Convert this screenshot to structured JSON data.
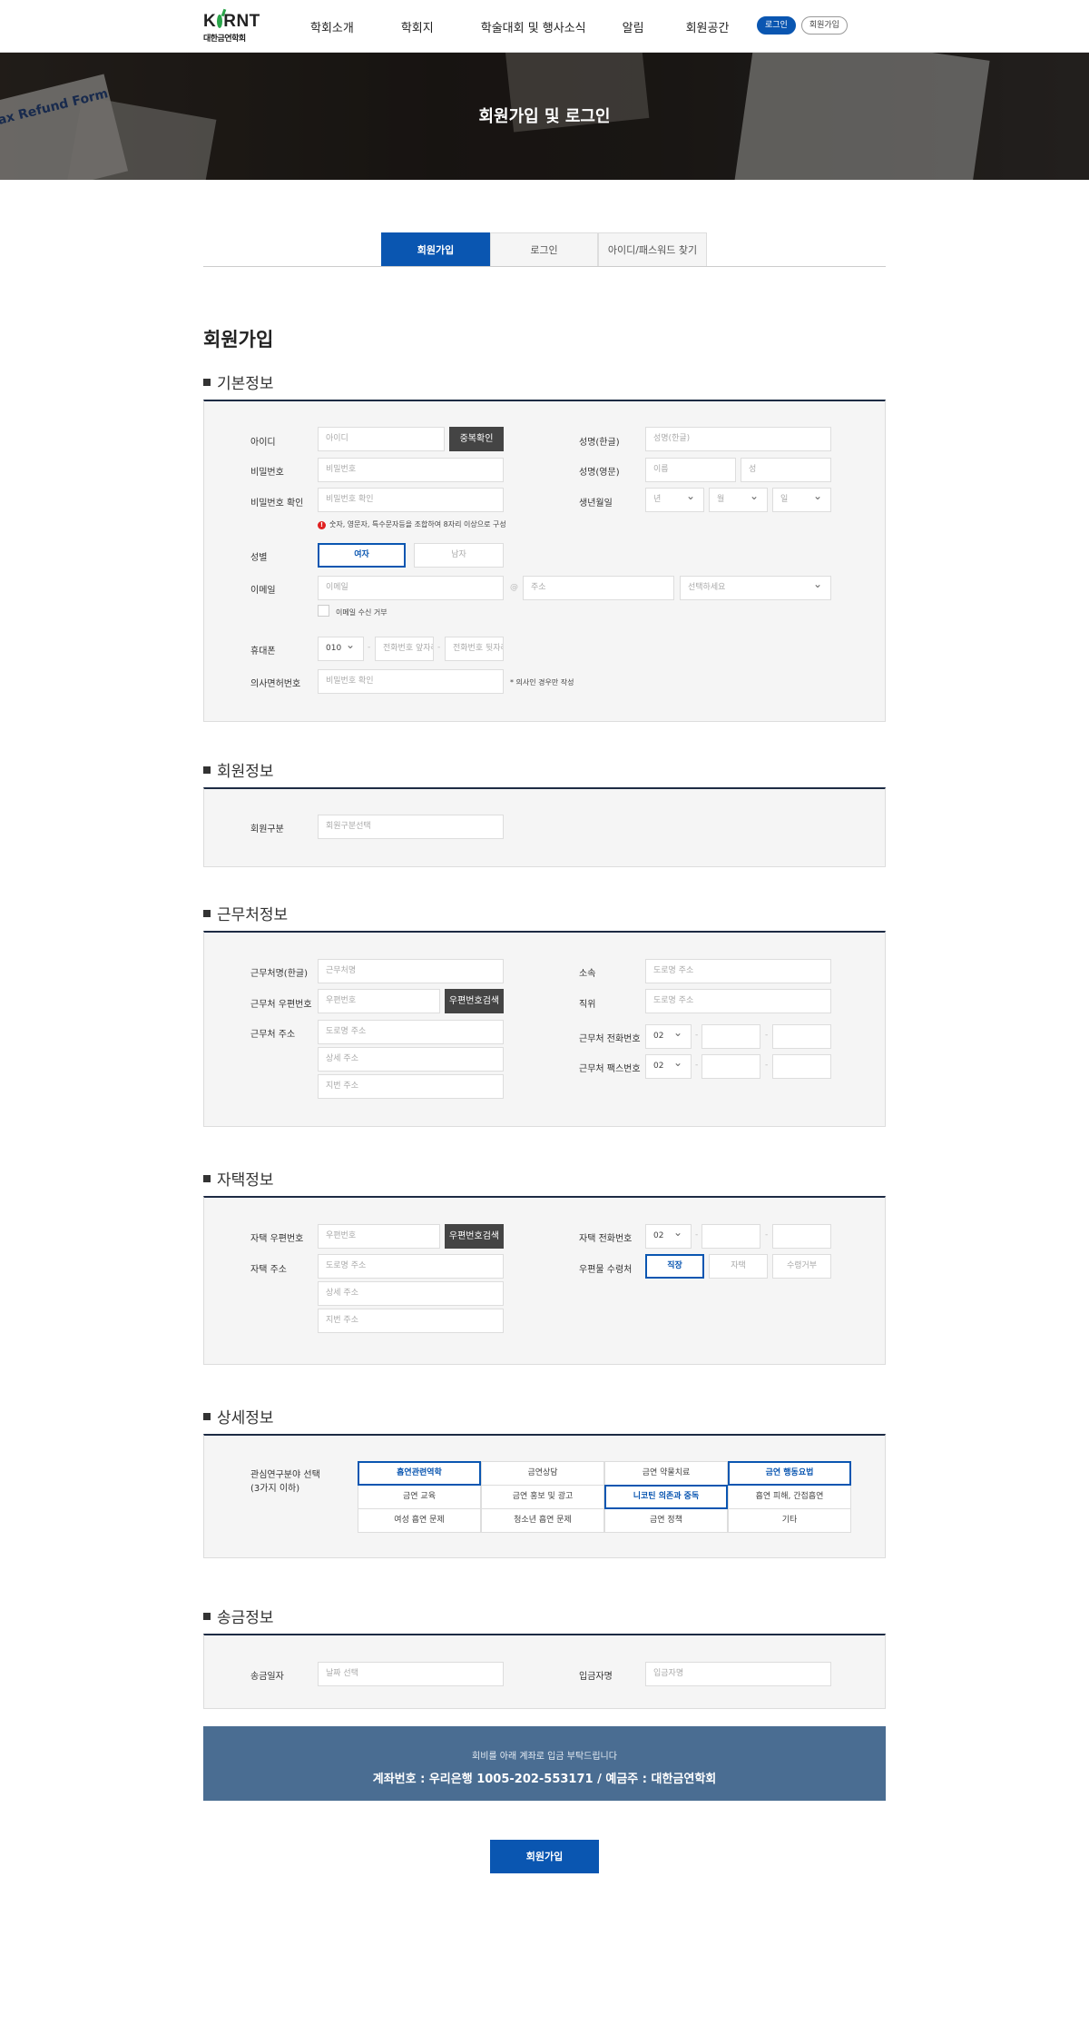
{
  "header": {
    "logo_text": "KORNT",
    "logo_sub": "대한금연학회",
    "nav": [
      "학회소개",
      "학회지",
      "학술대회 및 행사소식",
      "알림",
      "회원공간"
    ],
    "login_button": "로그인",
    "join_button": "회원가입"
  },
  "banner": {
    "title": "회원가입 및 로그인",
    "paper_text": "ax Refund Form"
  },
  "tabs": [
    "회원가입",
    "로그인",
    "아이디/패스워드 찾기"
  ],
  "page_title": "회원가입",
  "basic": {
    "title": "기본정보",
    "id_label": "아이디",
    "id_placeholder": "아이디",
    "dup_check": "중복확인",
    "pw_label": "비밀번호",
    "pw_placeholder": "비밀번호",
    "pw2_label": "비밀번호 확인",
    "pw2_placeholder": "비밀번호 확인",
    "pw_note": "숫자, 영문자, 특수문자등을 조합하여 8자리 이상으로 구성",
    "name_ko_label": "성명(한글)",
    "name_ko_placeholder": "성명(한글)",
    "name_en_label": "성명(영문)",
    "first_placeholder": "이름",
    "last_placeholder": "성",
    "birth_label": "생년월일",
    "year": "년",
    "month": "월",
    "day": "일",
    "gender_label": "성별",
    "female": "여자",
    "male": "남자",
    "email_label": "이메일",
    "email_id_placeholder": "이메일",
    "at": "@",
    "email_domain_placeholder": "주소",
    "email_select": "선택하세요",
    "email_agree": "이메일 수신 거부",
    "phone_label": "휴대폰",
    "phone_prefix": "010",
    "phone_mid": "전화번호 앞자리",
    "phone_last": "전화번호 뒷자리",
    "dash": "-",
    "license_label": "의사면허번호",
    "license_placeholder": "비밀번호 확인",
    "license_note": "* 의사인 경우만 작성"
  },
  "member": {
    "title": "회원정보",
    "type_label": "회원구분",
    "type_placeholder": "회원구분선택"
  },
  "work": {
    "title": "근무처정보",
    "name_label": "근무처명(한글)",
    "name_placeholder": "근무처명",
    "zip_label": "근무처 우편번호",
    "zip_placeholder": "우편번호",
    "zip_button": "우편번호검색",
    "addr_label": "근무처 주소",
    "addr1": "도로명 주소",
    "addr2": "상세 주소",
    "addr3": "지번 주소",
    "dept_label": "소속",
    "dept_placeholder": "도로명 주소",
    "position_label": "직위",
    "position_placeholder": "도로명 주소",
    "tel_label": "근무처 전화번호",
    "fax_label": "근무처 팩스번호",
    "area_code": "02"
  },
  "home": {
    "title": "자택정보",
    "zip_label": "자택 우편번호",
    "zip_placeholder": "우편번호",
    "zip_button": "우편번호검색",
    "addr_label": "자택 주소",
    "addr1": "도로명 주소",
    "addr2": "상세 주소",
    "addr3": "지번 주소",
    "tel_label": "자택 전화번호",
    "area_code": "02",
    "mail_label": "우편물 수령처",
    "mail_options": [
      "직장",
      "자택",
      "수령거부"
    ]
  },
  "detail": {
    "title": "상세정보",
    "interest_label_1": "관심연구분야 선택",
    "interest_label_2": "(3가지 이하)",
    "items": [
      "흡연관련역학",
      "금연상담",
      "금연 약물치료",
      "금연 행동요법",
      "금연 교육",
      "금연 홍보 및 광고",
      "니코틴 의존과 중독",
      "흡연 피해, 간접흡연",
      "여성 흡연 문제",
      "청소년 흡연 문제",
      "금연 정책",
      "기타"
    ],
    "selected": [
      0,
      3,
      6
    ]
  },
  "payment": {
    "title": "송금정보",
    "date_label": "송금일자",
    "date_placeholder": "날짜 선택",
    "payer_label": "입금자명",
    "payer_placeholder": "입금자명"
  },
  "account": {
    "guide": "회비를 아래 계좌로 입금 부탁드립니다",
    "info": "계좌번호 : 우리은행 1005-202-553171 / 예금주 : 대한금연학회"
  },
  "submit_label": "회원가입",
  "colors": {
    "primary": "#0a56b1",
    "account_bg": "#4a6d92",
    "section_rule": "#1d2b44"
  }
}
